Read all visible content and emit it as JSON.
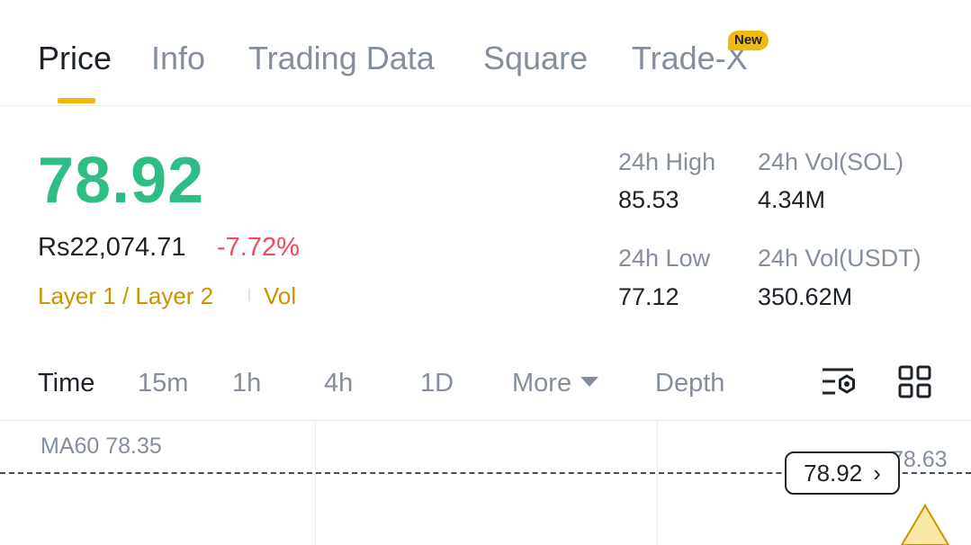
{
  "tabs": [
    {
      "label": "Price",
      "active": true
    },
    {
      "label": "Info",
      "active": false
    },
    {
      "label": "Trading Data",
      "active": false
    },
    {
      "label": "Square",
      "active": false
    },
    {
      "label": "Trade-X",
      "active": false,
      "badge": "New"
    }
  ],
  "price": {
    "last": "78.92",
    "fiat": "Rs22,074.71",
    "change": "-7.72%",
    "tags": [
      "Layer 1 / Layer 2",
      "Vol"
    ]
  },
  "stats": {
    "high_label": "24h High",
    "high_value": "85.53",
    "low_label": "24h Low",
    "low_value": "77.12",
    "vol_base_label": "24h Vol(SOL)",
    "vol_base_value": "4.34M",
    "vol_quote_label": "24h Vol(USDT)",
    "vol_quote_value": "350.62M"
  },
  "intervals": {
    "items": [
      "Time",
      "15m",
      "1h",
      "4h",
      "1D"
    ],
    "active": "Time",
    "more_label": "More",
    "depth_label": "Depth"
  },
  "chart": {
    "ma_label": "MA60 78.35",
    "axis_price": "78.63",
    "current_price": "78.92",
    "pill_arrow": "›"
  },
  "colors": {
    "up": "#2ebd85",
    "down": "#f6465d",
    "accent": "#f0b90b",
    "tag": "#c99400"
  },
  "icons": [
    "indicator-settings-icon",
    "grid-layout-icon",
    "chevron-right-icon",
    "caret-down-icon",
    "position-marker-icon"
  ]
}
